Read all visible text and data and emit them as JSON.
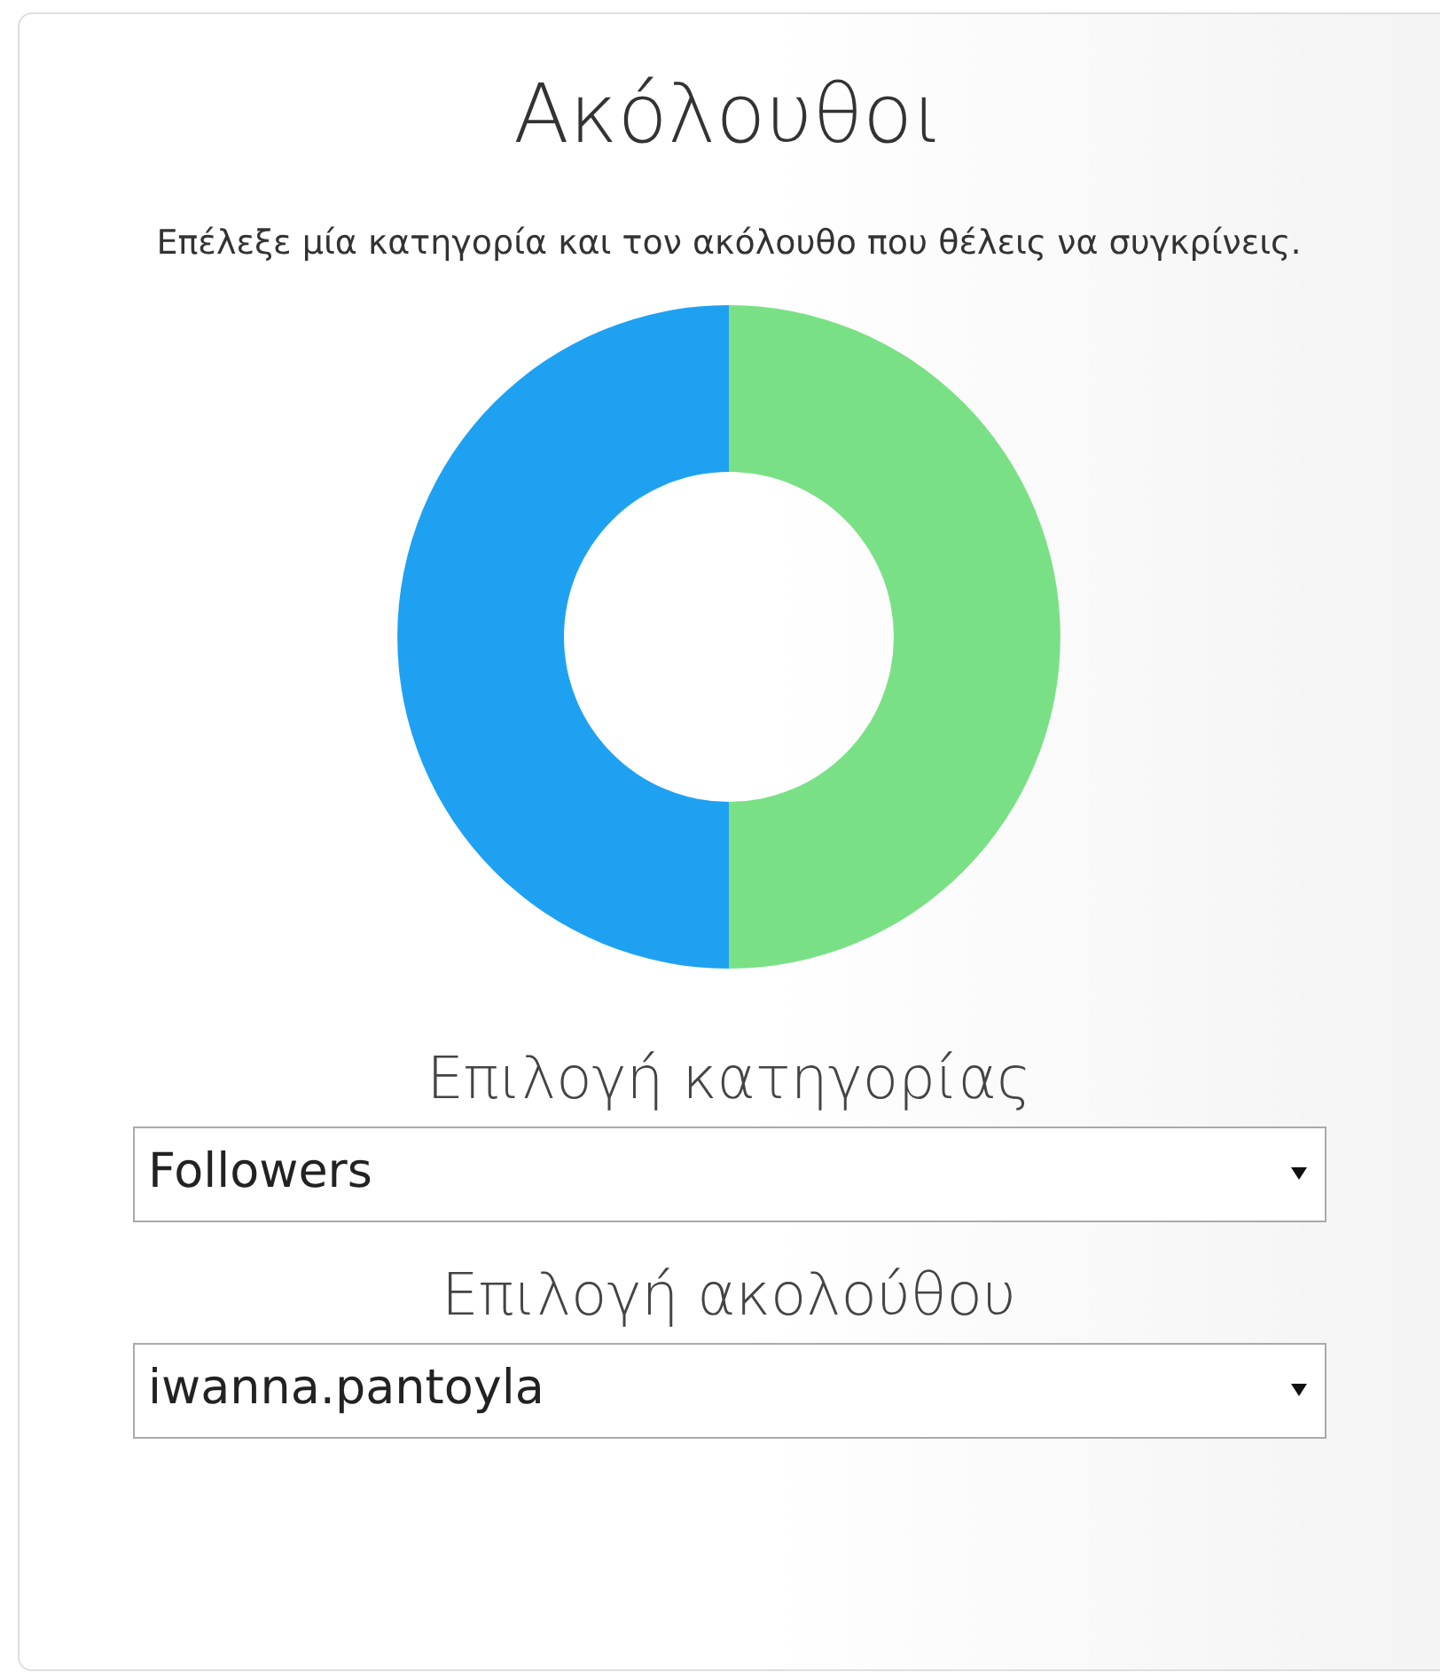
{
  "title": "Ακόλουθοι",
  "instruction": "Επέλεξε μία κατηγορία και τον ακόλουθο που θέλεις να συγκρίνεις.",
  "selects": [
    {
      "label": "Επιλογή κατηγορίας",
      "value": "Followers"
    },
    {
      "label": "Επιλογή ακολούθου",
      "value": "iwanna.pantoyla"
    }
  ]
}
